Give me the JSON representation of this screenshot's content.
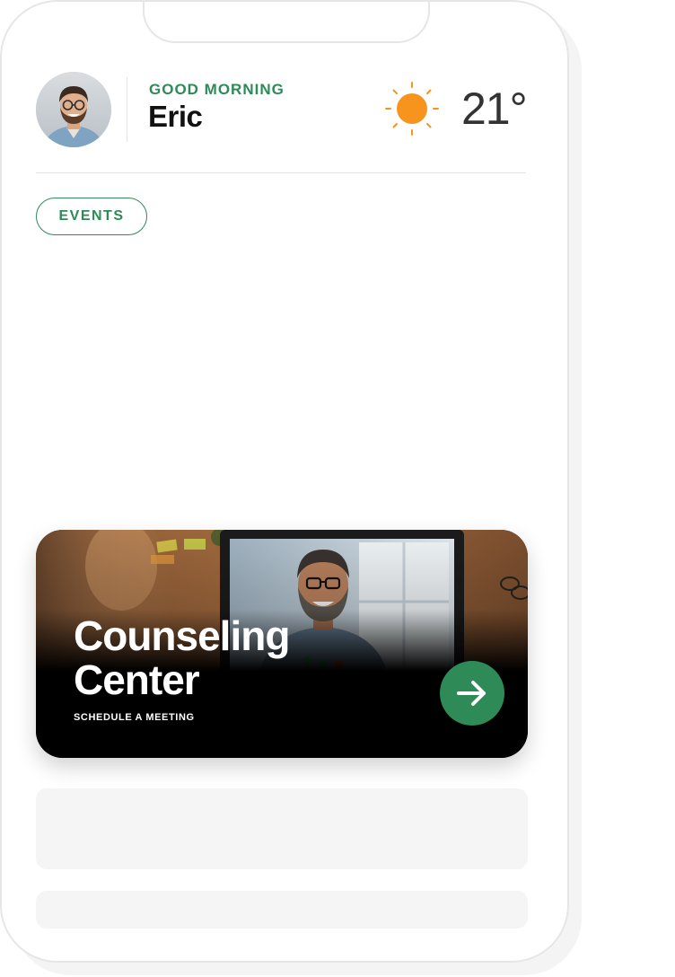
{
  "header": {
    "greeting": "GOOD MORNING",
    "user_name": "Eric",
    "avatar": "user-avatar-photo",
    "weather_icon": "sun-icon",
    "temperature": "21°"
  },
  "filter_chip": {
    "label": "EVENTS"
  },
  "feature_card": {
    "title": "Counseling Center",
    "subtitle": "SCHEDULE A MEETING",
    "image": "video-call-photo",
    "action_icon": "arrow-right-icon"
  },
  "colors": {
    "accent": "#2e8b57",
    "sun": "#f7941d",
    "card_background": "#000000",
    "placeholder": "#f5f5f5"
  }
}
